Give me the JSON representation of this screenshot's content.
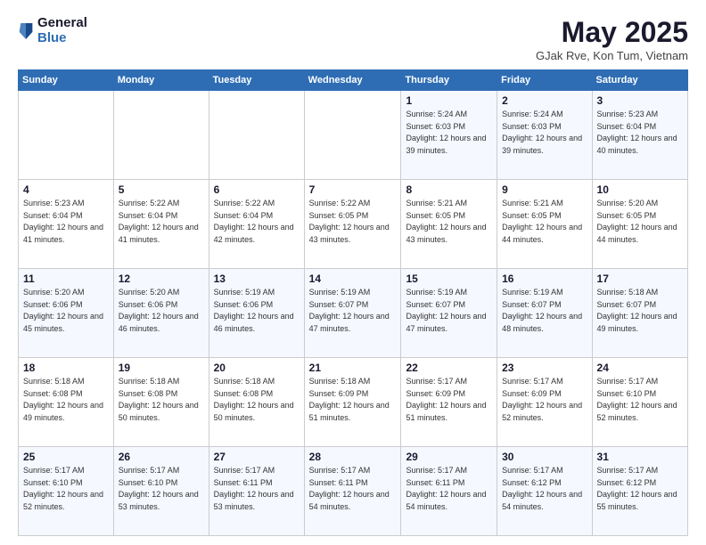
{
  "logo": {
    "general": "General",
    "blue": "Blue"
  },
  "title": {
    "month": "May 2025",
    "location": "GJak Rve, Kon Tum, Vietnam"
  },
  "weekdays": [
    "Sunday",
    "Monday",
    "Tuesday",
    "Wednesday",
    "Thursday",
    "Friday",
    "Saturday"
  ],
  "weeks": [
    [
      null,
      null,
      null,
      null,
      {
        "day": "1",
        "sunrise": "Sunrise: 5:24 AM",
        "sunset": "Sunset: 6:03 PM",
        "daylight": "Daylight: 12 hours and 39 minutes."
      },
      {
        "day": "2",
        "sunrise": "Sunrise: 5:24 AM",
        "sunset": "Sunset: 6:03 PM",
        "daylight": "Daylight: 12 hours and 39 minutes."
      },
      {
        "day": "3",
        "sunrise": "Sunrise: 5:23 AM",
        "sunset": "Sunset: 6:04 PM",
        "daylight": "Daylight: 12 hours and 40 minutes."
      }
    ],
    [
      {
        "day": "4",
        "sunrise": "Sunrise: 5:23 AM",
        "sunset": "Sunset: 6:04 PM",
        "daylight": "Daylight: 12 hours and 41 minutes."
      },
      {
        "day": "5",
        "sunrise": "Sunrise: 5:22 AM",
        "sunset": "Sunset: 6:04 PM",
        "daylight": "Daylight: 12 hours and 41 minutes."
      },
      {
        "day": "6",
        "sunrise": "Sunrise: 5:22 AM",
        "sunset": "Sunset: 6:04 PM",
        "daylight": "Daylight: 12 hours and 42 minutes."
      },
      {
        "day": "7",
        "sunrise": "Sunrise: 5:22 AM",
        "sunset": "Sunset: 6:05 PM",
        "daylight": "Daylight: 12 hours and 43 minutes."
      },
      {
        "day": "8",
        "sunrise": "Sunrise: 5:21 AM",
        "sunset": "Sunset: 6:05 PM",
        "daylight": "Daylight: 12 hours and 43 minutes."
      },
      {
        "day": "9",
        "sunrise": "Sunrise: 5:21 AM",
        "sunset": "Sunset: 6:05 PM",
        "daylight": "Daylight: 12 hours and 44 minutes."
      },
      {
        "day": "10",
        "sunrise": "Sunrise: 5:20 AM",
        "sunset": "Sunset: 6:05 PM",
        "daylight": "Daylight: 12 hours and 44 minutes."
      }
    ],
    [
      {
        "day": "11",
        "sunrise": "Sunrise: 5:20 AM",
        "sunset": "Sunset: 6:06 PM",
        "daylight": "Daylight: 12 hours and 45 minutes."
      },
      {
        "day": "12",
        "sunrise": "Sunrise: 5:20 AM",
        "sunset": "Sunset: 6:06 PM",
        "daylight": "Daylight: 12 hours and 46 minutes."
      },
      {
        "day": "13",
        "sunrise": "Sunrise: 5:19 AM",
        "sunset": "Sunset: 6:06 PM",
        "daylight": "Daylight: 12 hours and 46 minutes."
      },
      {
        "day": "14",
        "sunrise": "Sunrise: 5:19 AM",
        "sunset": "Sunset: 6:07 PM",
        "daylight": "Daylight: 12 hours and 47 minutes."
      },
      {
        "day": "15",
        "sunrise": "Sunrise: 5:19 AM",
        "sunset": "Sunset: 6:07 PM",
        "daylight": "Daylight: 12 hours and 47 minutes."
      },
      {
        "day": "16",
        "sunrise": "Sunrise: 5:19 AM",
        "sunset": "Sunset: 6:07 PM",
        "daylight": "Daylight: 12 hours and 48 minutes."
      },
      {
        "day": "17",
        "sunrise": "Sunrise: 5:18 AM",
        "sunset": "Sunset: 6:07 PM",
        "daylight": "Daylight: 12 hours and 49 minutes."
      }
    ],
    [
      {
        "day": "18",
        "sunrise": "Sunrise: 5:18 AM",
        "sunset": "Sunset: 6:08 PM",
        "daylight": "Daylight: 12 hours and 49 minutes."
      },
      {
        "day": "19",
        "sunrise": "Sunrise: 5:18 AM",
        "sunset": "Sunset: 6:08 PM",
        "daylight": "Daylight: 12 hours and 50 minutes."
      },
      {
        "day": "20",
        "sunrise": "Sunrise: 5:18 AM",
        "sunset": "Sunset: 6:08 PM",
        "daylight": "Daylight: 12 hours and 50 minutes."
      },
      {
        "day": "21",
        "sunrise": "Sunrise: 5:18 AM",
        "sunset": "Sunset: 6:09 PM",
        "daylight": "Daylight: 12 hours and 51 minutes."
      },
      {
        "day": "22",
        "sunrise": "Sunrise: 5:17 AM",
        "sunset": "Sunset: 6:09 PM",
        "daylight": "Daylight: 12 hours and 51 minutes."
      },
      {
        "day": "23",
        "sunrise": "Sunrise: 5:17 AM",
        "sunset": "Sunset: 6:09 PM",
        "daylight": "Daylight: 12 hours and 52 minutes."
      },
      {
        "day": "24",
        "sunrise": "Sunrise: 5:17 AM",
        "sunset": "Sunset: 6:10 PM",
        "daylight": "Daylight: 12 hours and 52 minutes."
      }
    ],
    [
      {
        "day": "25",
        "sunrise": "Sunrise: 5:17 AM",
        "sunset": "Sunset: 6:10 PM",
        "daylight": "Daylight: 12 hours and 52 minutes."
      },
      {
        "day": "26",
        "sunrise": "Sunrise: 5:17 AM",
        "sunset": "Sunset: 6:10 PM",
        "daylight": "Daylight: 12 hours and 53 minutes."
      },
      {
        "day": "27",
        "sunrise": "Sunrise: 5:17 AM",
        "sunset": "Sunset: 6:11 PM",
        "daylight": "Daylight: 12 hours and 53 minutes."
      },
      {
        "day": "28",
        "sunrise": "Sunrise: 5:17 AM",
        "sunset": "Sunset: 6:11 PM",
        "daylight": "Daylight: 12 hours and 54 minutes."
      },
      {
        "day": "29",
        "sunrise": "Sunrise: 5:17 AM",
        "sunset": "Sunset: 6:11 PM",
        "daylight": "Daylight: 12 hours and 54 minutes."
      },
      {
        "day": "30",
        "sunrise": "Sunrise: 5:17 AM",
        "sunset": "Sunset: 6:12 PM",
        "daylight": "Daylight: 12 hours and 54 minutes."
      },
      {
        "day": "31",
        "sunrise": "Sunrise: 5:17 AM",
        "sunset": "Sunset: 6:12 PM",
        "daylight": "Daylight: 12 hours and 55 minutes."
      }
    ]
  ]
}
